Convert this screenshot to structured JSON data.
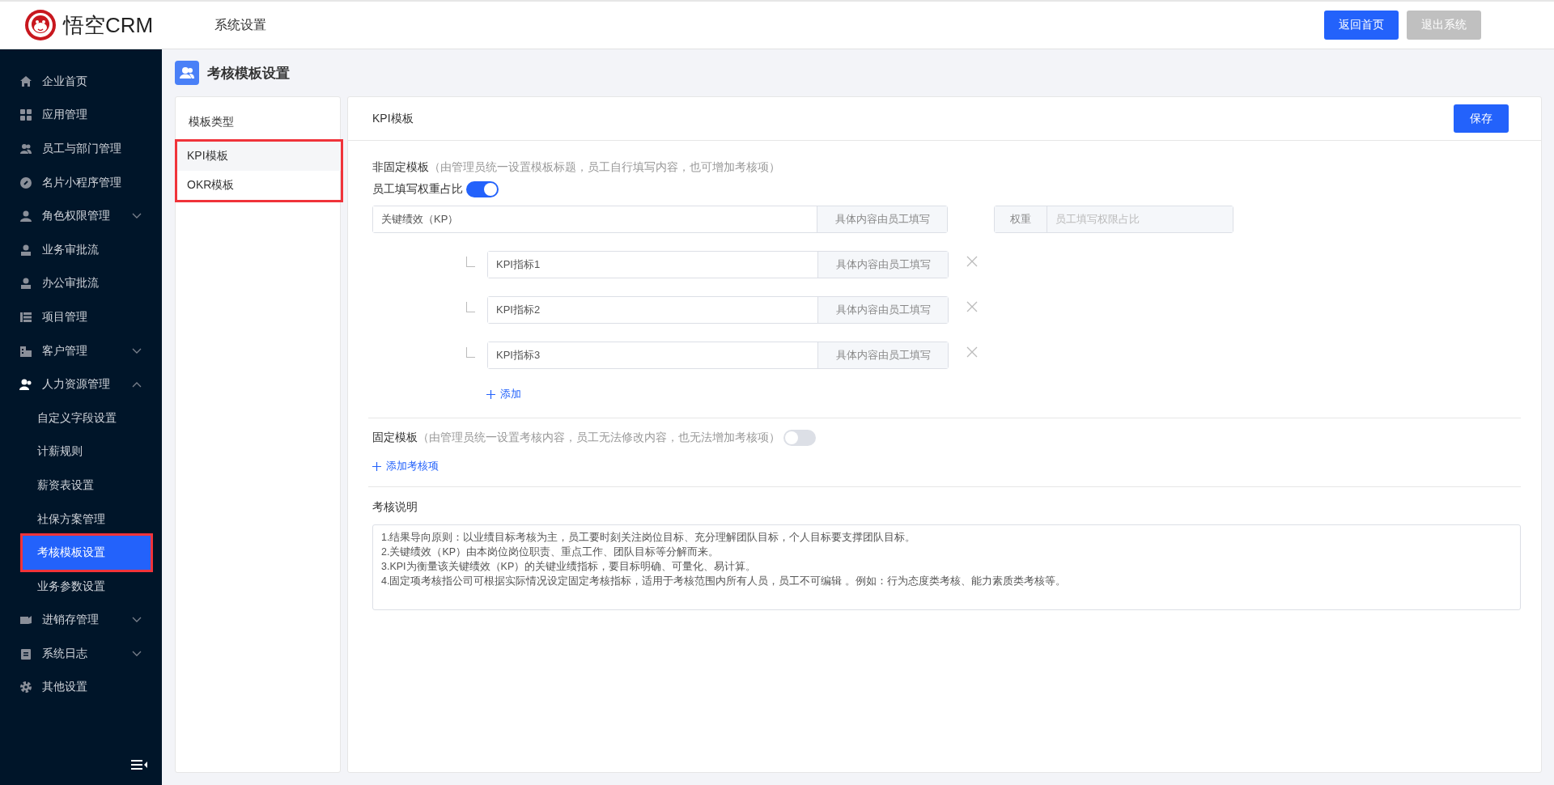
{
  "header": {
    "logo_text": "悟空CRM",
    "title": "系统设置",
    "buttons": [
      {
        "label": "返回首页",
        "kind": "primary"
      },
      {
        "label": "退出系统",
        "kind": "muted"
      }
    ]
  },
  "sidebar": {
    "items": [
      {
        "label": "企业首页"
      },
      {
        "label": "应用管理"
      },
      {
        "label": "员工与部门管理"
      },
      {
        "label": "名片小程序管理"
      },
      {
        "label": "角色权限管理",
        "expanded": false
      },
      {
        "label": "业务审批流"
      },
      {
        "label": "办公审批流"
      },
      {
        "label": "项目管理"
      },
      {
        "label": "客户管理",
        "expanded": false
      },
      {
        "label": "人力资源管理",
        "expanded": true,
        "children": [
          {
            "label": "自定义字段设置",
            "selected": false,
            "highlighted": false
          },
          {
            "label": "计薪规则",
            "selected": false,
            "highlighted": false
          },
          {
            "label": "薪资表设置",
            "selected": false,
            "highlighted": false
          },
          {
            "label": "社保方案管理",
            "selected": false,
            "highlighted": false
          },
          {
            "label": "考核模板设置",
            "selected": true,
            "highlighted": true
          },
          {
            "label": "业务参数设置",
            "selected": false,
            "highlighted": false
          }
        ]
      },
      {
        "label": "进销存管理",
        "expanded": false
      },
      {
        "label": "系统日志",
        "expanded": false
      },
      {
        "label": "其他设置"
      }
    ]
  },
  "page_title": "考核模板设置",
  "templates": {
    "heading": "模板类型",
    "highlighted": true,
    "items": [
      {
        "label": "KPI模板",
        "selected": true
      },
      {
        "label": "OKR模板",
        "selected": false
      }
    ]
  },
  "editor": {
    "title": "KPI模板",
    "save": "保存",
    "variable": {
      "title": "非固定模板",
      "note": "（由管理员统一设置模板标题，员工自行填写内容，也可增加考核项）",
      "weight_label": "员工填写权重占比",
      "weight_on": true,
      "main": {
        "value": "关键绩效（KP）",
        "addon": "具体内容由员工填写"
      },
      "weight": {
        "label": "权重",
        "placeholder": "员工填写权限占比"
      },
      "indicators": [
        {
          "value": "KPI指标1",
          "addon": "具体内容由员工填写"
        },
        {
          "value": "KPI指标2",
          "addon": "具体内容由员工填写"
        },
        {
          "value": "KPI指标3",
          "addon": "具体内容由员工填写"
        }
      ],
      "add_label": "添加"
    },
    "fixed": {
      "title": "固定模板",
      "note": "（由管理员统一设置考核内容，员工无法修改内容，也无法增加考核项）",
      "on": false,
      "add_label": "添加考核项"
    },
    "description": {
      "label": "考核说明",
      "lines": [
        "1.结果导向原则：以业绩目标考核为主，员工要时刻关注岗位目标、充分理解团队目标，个人目标要支撑团队目标。",
        "2.关键绩效（KP）由本岗位岗位职责、重点工作、团队目标等分解而来。",
        "3.KPI为衡量该关键绩效（KP）的关键业绩指标，要目标明确、可量化、易计算。",
        "4.固定项考核指公司可根据实际情况设定固定考核指标，适用于考核范围内所有人员，员工不可编辑 。例如：行为态度类考核、能力素质类考核等。"
      ]
    }
  }
}
